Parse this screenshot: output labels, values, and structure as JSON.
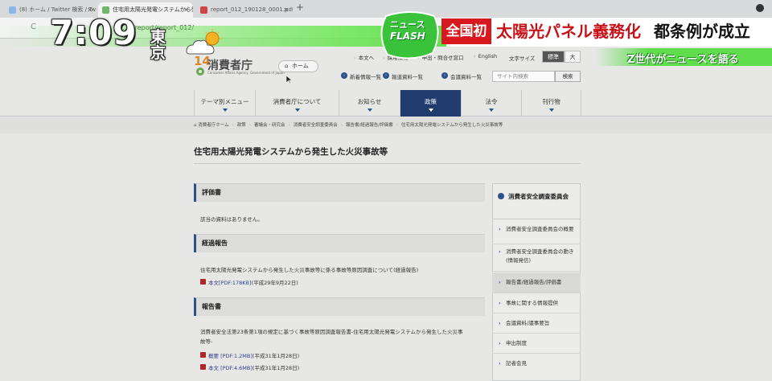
{
  "browser": {
    "tabs": [
      {
        "title": "(8) ホーム / Twitter 検索 / Tw",
        "close": "✕"
      },
      {
        "title": "住宅用太陽光発電システムから発生",
        "close": "✕"
      },
      {
        "title": "report_012_190128_0001.pdf",
        "close": "✕"
      }
    ],
    "new_tab": "+",
    "address": "...jp/report/report_012/",
    "reload": "C"
  },
  "site": {
    "logo_number": "14",
    "logo_text": "消費者庁",
    "logo_sub": "Consumer Affairs Agency, Government of Japan",
    "home_label": "ホーム",
    "home_icon": "house-icon",
    "util_links": [
      "本文へ",
      "採用情報",
      "申出・問合せ窓口",
      "English"
    ],
    "font_size_label": "文字サイズ",
    "font_size_standard": "標準",
    "font_size_large": "大",
    "sec_links": [
      "新着情報一覧",
      "報道資料一覧",
      "会議資料一覧"
    ],
    "search_placeholder": "サイト内検索",
    "search_button": "検索"
  },
  "gnav": [
    "テーマ別メニュー",
    "消費者庁について",
    "お知らせ",
    "政策",
    "法令",
    "刊行物"
  ],
  "breadcrumb": [
    "消費者庁ホーム",
    "政策",
    "審議会・研究会",
    "消費者安全調査委員会",
    "報告書/経過報告/評価書",
    "住宅用太陽光発電システムから発生した火災事故等"
  ],
  "page_title": "住宅用太陽光発電システムから発生した火災事故等",
  "sections": {
    "evaluation": {
      "heading": "評価書",
      "text": "該当の資料はありません。"
    },
    "progress": {
      "heading": "経過報告",
      "text": "住宅用太陽光発電システムから発生した火災事故等に係る事故等原因調査について(経過報告)",
      "pdf_link": "本文[PDF:178KB]",
      "pdf_date": "(平成29年9月22日)"
    },
    "report": {
      "heading": "報告書",
      "text_line1": "消費者安全法第23条第1項の規定に基づく事故等原因調査報告書-住宅用太陽光発電システムから発生した火災事",
      "text_line2": "故等-",
      "pdf1_label": "概要",
      "pdf1_size": "[PDF:1.2MB]",
      "pdf1_date": "(平成31年1月28日)",
      "pdf2_label": "本文",
      "pdf2_size": "[PDF:4.6MB]",
      "pdf2_date": "(平成31年1月28日)"
    }
  },
  "side_menu": {
    "heading": "消費者安全調査委員会",
    "items": [
      "消費者安全調査委員会の概要",
      "消費者安全調査委員会の動き(情報発信)",
      "報告書/経過報告/評価書",
      "事故に関する情報提供",
      "会議資料/議事要旨",
      "申出制度",
      "記者会見"
    ]
  },
  "tv_overlay": {
    "time": "7:09",
    "city": "東京",
    "weather_icon": "sun-cloud-icon",
    "flash_top": "ニュース",
    "flash_bottom": "FLASH",
    "headline_tag": "全国初",
    "headline_main": "太陽光パネル義務化",
    "headline_end": "都条例が成立",
    "sub_caption": "Z世代がニュースを語る"
  }
}
